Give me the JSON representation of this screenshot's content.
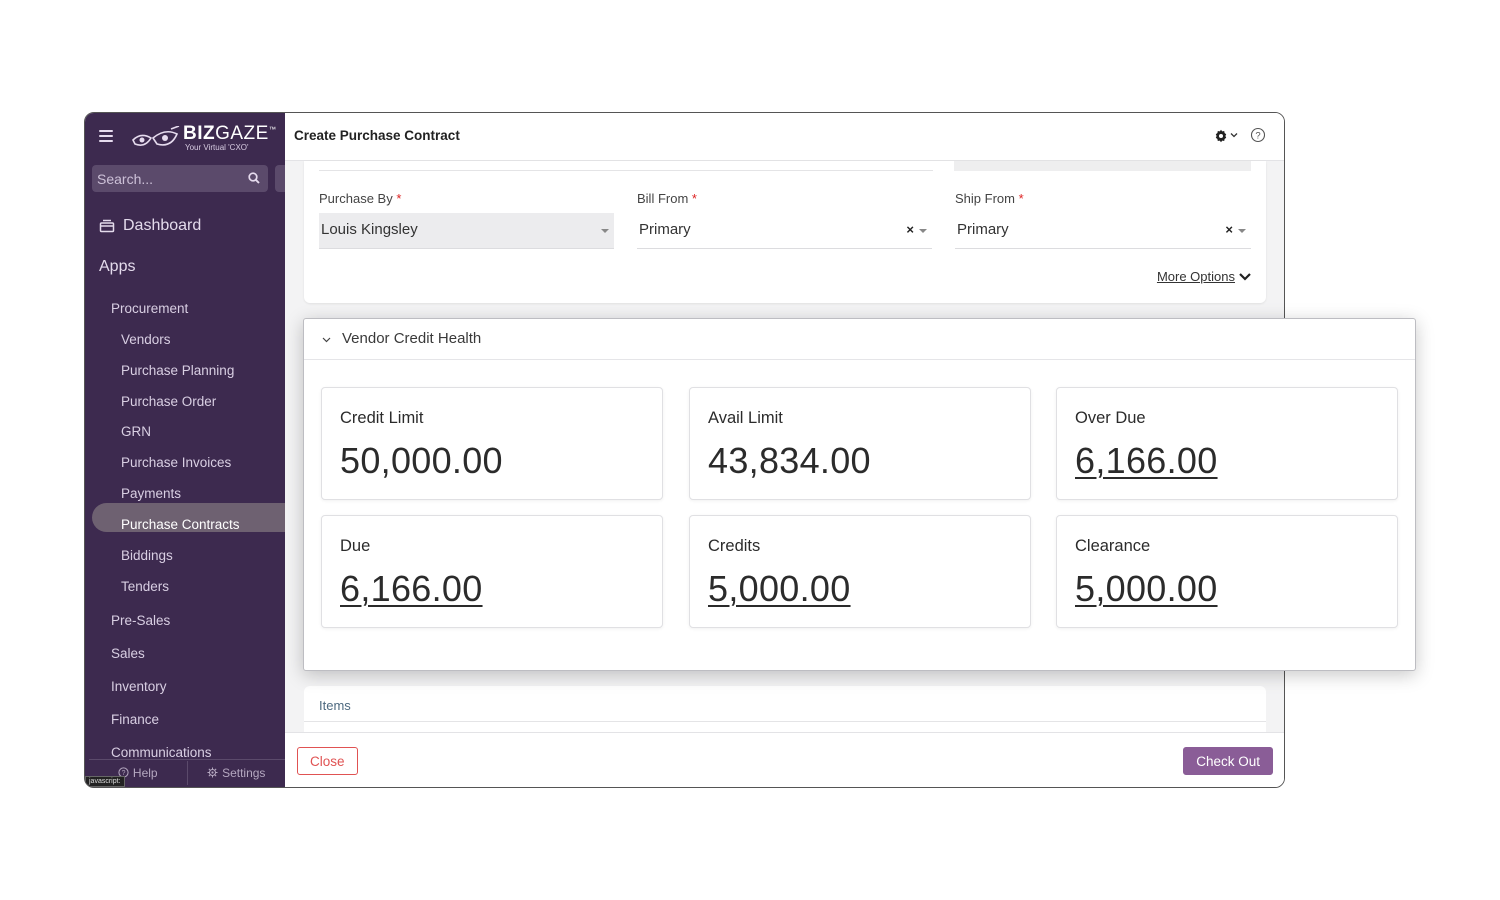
{
  "sidebar": {
    "brand_bold": "BIZ",
    "brand_light": "GAZE",
    "brand_tm": "™",
    "tagline": "Your Virtual 'CXO'",
    "search_placeholder": "Search...",
    "dashboard": "Dashboard",
    "apps": "Apps",
    "items": [
      {
        "label": "Procurement",
        "level": 1
      },
      {
        "label": "Vendors",
        "level": 2
      },
      {
        "label": "Purchase Planning",
        "level": 2
      },
      {
        "label": "Purchase Order",
        "level": 2
      },
      {
        "label": "GRN",
        "level": 2
      },
      {
        "label": "Purchase Invoices",
        "level": 2
      },
      {
        "label": "Payments",
        "level": 2
      },
      {
        "label": "Purchase Contracts",
        "level": 2,
        "active": true
      },
      {
        "label": "Biddings",
        "level": 2
      },
      {
        "label": "Tenders",
        "level": 2
      },
      {
        "label": "Pre-Sales",
        "level": 1
      },
      {
        "label": "Sales",
        "level": 1
      },
      {
        "label": "Inventory",
        "level": 1
      },
      {
        "label": "Finance",
        "level": 1
      },
      {
        "label": "Communications",
        "level": 1
      }
    ],
    "footer_help": "Help",
    "footer_settings": "Settings",
    "status_tip": "javascript:"
  },
  "header": {
    "title": "Create Purchase Contract"
  },
  "form": {
    "purchase_by_label": "Purchase By",
    "purchase_by_value": "Louis Kingsley",
    "bill_from_label": "Bill From",
    "bill_from_value": "Primary",
    "ship_from_label": "Ship From",
    "ship_from_value": "Primary",
    "required_mark": "*",
    "clear_glyph": "×",
    "more_options": "More Options"
  },
  "panel": {
    "title": "Vendor Credit Health",
    "stats": [
      {
        "label": "Credit Limit",
        "value": "50,000.00",
        "link": false
      },
      {
        "label": "Avail Limit",
        "value": "43,834.00",
        "link": false
      },
      {
        "label": "Over Due",
        "value": "6,166.00",
        "link": true
      },
      {
        "label": "Due",
        "value": "6,166.00",
        "link": true
      },
      {
        "label": "Credits",
        "value": "5,000.00",
        "link": true
      },
      {
        "label": "Clearance",
        "value": "5,000.00",
        "link": true
      }
    ]
  },
  "items_section": {
    "label": "Items"
  },
  "footer": {
    "close": "Close",
    "checkout": "Check Out"
  },
  "colors": {
    "sidebar_bg": "#3d2a4f",
    "accent": "#8a5d97",
    "danger": "#e05252"
  }
}
